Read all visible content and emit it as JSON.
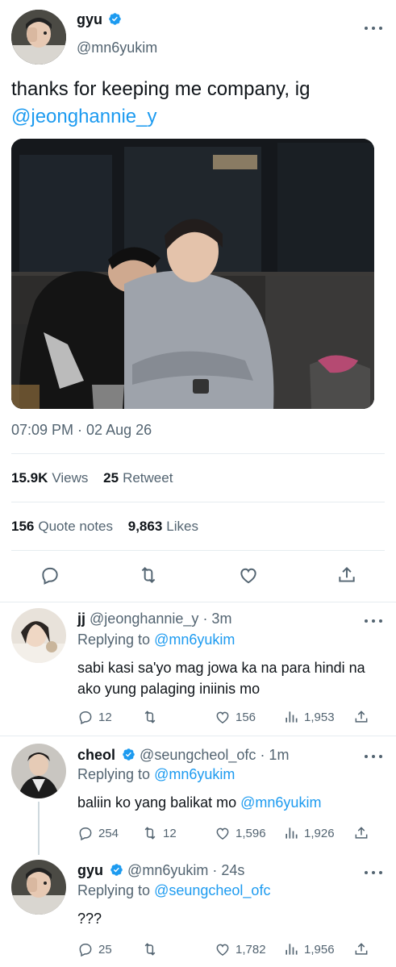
{
  "tweet": {
    "author_name": "gyu",
    "author_handle": "@mn6yukim",
    "text": "thanks for keeping me company, ig",
    "mention": "@jeonghannie_y",
    "timestamp": "07:09 PM · 02 Aug 26",
    "views_count": "15.9K",
    "views_label": "Views",
    "retweets_count": "25",
    "retweets_label": "Retweet",
    "quotes_count": "156",
    "quotes_label": "Quote notes",
    "likes_count": "9,863",
    "likes_label": "Likes"
  },
  "replies": [
    {
      "name": "jj",
      "handle": "@jeonghannie_y",
      "time": "· 3m",
      "replying_label": "Replying to",
      "replying_to": "@mn6yukim",
      "text": "sabi kasi sa'yo mag jowa ka na para hindi na ako yung palaging iniinis mo",
      "text_mention": "",
      "replies": "12",
      "retweets": "",
      "likes": "156",
      "views": "1,953"
    },
    {
      "name": "cheol",
      "handle": "@seungcheol_ofc",
      "time": "· 1m",
      "replying_label": "Replying to",
      "replying_to": "@mn6yukim",
      "text": "baliin ko yang balikat mo",
      "text_mention": "@mn6yukim",
      "replies": "254",
      "retweets": "12",
      "likes": "1,596",
      "views": "1,926"
    },
    {
      "name": "gyu",
      "handle": "@mn6yukim",
      "time": "· 24s",
      "replying_label": "Replying to",
      "replying_to": "@seungcheol_ofc",
      "text": "???",
      "text_mention": "",
      "replies": "25",
      "retweets": "",
      "likes": "1,782",
      "views": "1,956"
    }
  ],
  "colors": {
    "accent": "#1d9bf0",
    "secondary_text": "#536471",
    "divider": "#e6ecf0"
  },
  "icons": [
    "more-icon",
    "verified-icon",
    "reply-icon",
    "retweet-icon",
    "like-icon",
    "share-icon",
    "views-icon"
  ]
}
